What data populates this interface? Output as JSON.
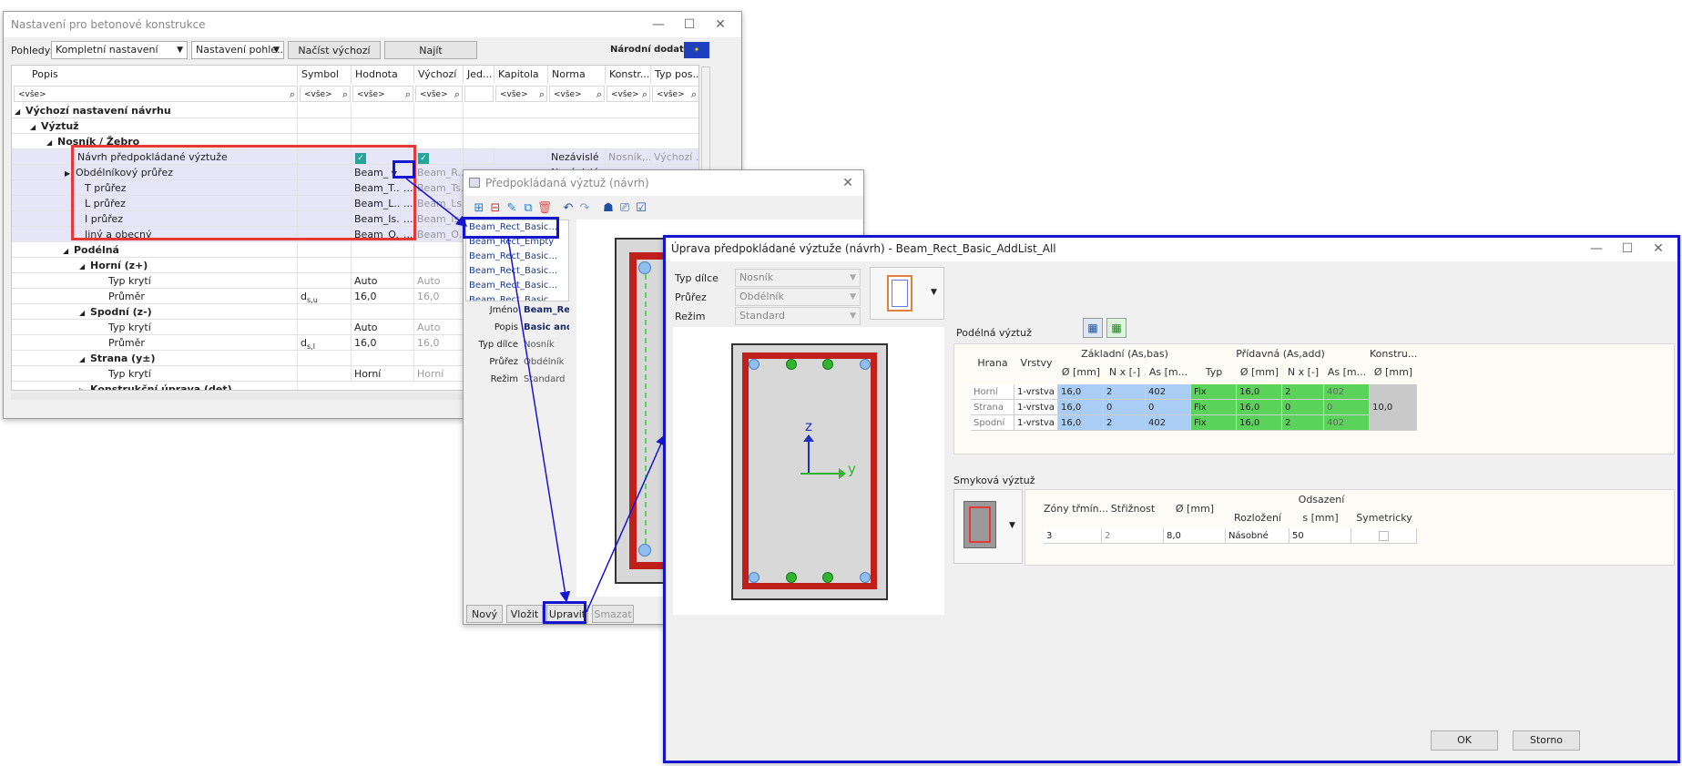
{
  "win1": {
    "title": "Nastavení pro betonové konstrukce",
    "views_label": "Pohledy:",
    "views_value": "Kompletní nastavení",
    "view_settings": "Nastavení pohle...",
    "load_default": "Načíst výchozí",
    "find": "Najít",
    "national_annex": "Národní dodatek:",
    "columns": [
      "Popis",
      "Symbol",
      "Hodnota",
      "Výchozí",
      "Jed...",
      "Kapitola",
      "Norma",
      "Konstr...",
      "Typ pos..."
    ],
    "filter": "<vše>",
    "rows": [
      {
        "label": "Výchozí nastavení návrhu"
      },
      {
        "label": "Výztuž"
      },
      {
        "label": "Nosník / Žebro"
      },
      {
        "label": "Návrh předpokládané výztuže",
        "norma": "Nezávislé",
        "konstr": "Nosník,...",
        "typ": "Výchozí ..."
      },
      {
        "label": "Obdélníkový průřez",
        "value": "Beam_",
        "default": "Beam_R...",
        "norma": "Nezávislé",
        "konstr": "Nosník",
        "typ": "Výchozí"
      },
      {
        "label": "T průřez",
        "value": "Beam_T...",
        "default": "Beam_Ts..."
      },
      {
        "label": "L průřez",
        "value": "Beam_L...",
        "default": "Beam_Ls..."
      },
      {
        "label": "I průřez",
        "value": "Beam_Is...",
        "default": "Beam_Is..."
      },
      {
        "label": "Jiný a obecný",
        "value": "Beam_O...",
        "default": "Beam_O..."
      },
      {
        "label": "Podélná"
      },
      {
        "label": "Horní (z+)"
      },
      {
        "label": "Typ krytí",
        "value": "Auto",
        "default": "Auto"
      },
      {
        "label": "Průměr",
        "symbol": "d",
        "symbol_sub": "s,u",
        "value": "16,0",
        "default": "16,0"
      },
      {
        "label": "Spodní (z-)"
      },
      {
        "label": "Typ krytí",
        "value": "Auto",
        "default": "Auto"
      },
      {
        "label": "Průměr",
        "symbol": "d",
        "symbol_sub": "s,l",
        "value": "16,0",
        "default": "16,0"
      },
      {
        "label": "Strana (y±)"
      },
      {
        "label": "Typ krytí",
        "value": "Horní",
        "default": "Horní"
      },
      {
        "label": "Konstrukční úprava (det)"
      }
    ],
    "ellipsis": "..."
  },
  "win2": {
    "title": "Předpokládaná výztuž (návrh)",
    "list": [
      "Beam_Rect_Basic...",
      "Beam_Rect_Empty",
      "Beam_Rect_Basic...",
      "Beam_Rect_Basic...",
      "Beam_Rect_Basic...",
      "Beam_Rect_Basic..."
    ],
    "props": [
      {
        "label": "Jméno",
        "value": "Beam_Re"
      },
      {
        "label": "Popis",
        "value": "Basic and"
      },
      {
        "label": "Typ dílce",
        "value": "Nosník"
      },
      {
        "label": "Průřez",
        "value": "Obdélník"
      },
      {
        "label": "Režim",
        "value": "Standard"
      }
    ],
    "buttons": {
      "new": "Nový",
      "insert": "Vložit",
      "edit": "Upravit",
      "delete": "Smazat"
    }
  },
  "win3": {
    "title": "Úprava předpokládané výztuže (návrh) - Beam_Rect_Basic_AddList_All",
    "member_type_label": "Typ dílce",
    "member_type_value": "Nosník",
    "section_label": "Průřez",
    "section_value": "Obdélník",
    "mode_label": "Režim",
    "mode_value": "Standard",
    "axis_z": "z",
    "axis_y": "y",
    "long_label": "Podélná výztuž",
    "long_headers": {
      "edge": "Hrana",
      "layers": "Vrstvy",
      "basic": "Základní (As,bas)",
      "additional": "Přídavná (As,add)",
      "constr": "Konstru...",
      "dia": "Ø [mm]",
      "n": "N x [-]",
      "as": "As [m...",
      "typ": "Typ"
    },
    "long_rows": [
      {
        "edge": "Horní",
        "layers": "1-vrstva",
        "d": "16,0",
        "n": "2",
        "as": "402",
        "typ": "Fix",
        "ad": "16,0",
        "an": "2",
        "aas": "402"
      },
      {
        "edge": "Strana",
        "layers": "1-vrstva",
        "d": "16,0",
        "n": "0",
        "as": "0",
        "typ": "Fix",
        "ad": "16,0",
        "an": "0",
        "aas": "0"
      },
      {
        "edge": "Spodní",
        "layers": "1-vrstva",
        "d": "16,0",
        "n": "2",
        "as": "402",
        "typ": "Fix",
        "ad": "16,0",
        "an": "2",
        "aas": "402"
      }
    ],
    "constr_value": "10,0",
    "shear_label": "Smyková výztuž",
    "shear_headers": {
      "zones": "Zóny třmín...",
      "shear": "Střižnost",
      "dia": "Ø [mm]",
      "offset": "Odsazení",
      "dist": "Rozložení",
      "s": "s [mm]",
      "sym": "Symetricky"
    },
    "shear_row": {
      "zones": "3",
      "shear": "2",
      "dia": "8,0",
      "dist": "Násobné",
      "s": "50"
    },
    "ok": "OK",
    "cancel": "Storno"
  },
  "colors": {
    "highlight_red": "#e53935",
    "highlight_blue": "#1515d0",
    "rebar_red": "#c0201b",
    "bar_green": "#2fb52f",
    "bar_blue": "#8fbfef"
  }
}
